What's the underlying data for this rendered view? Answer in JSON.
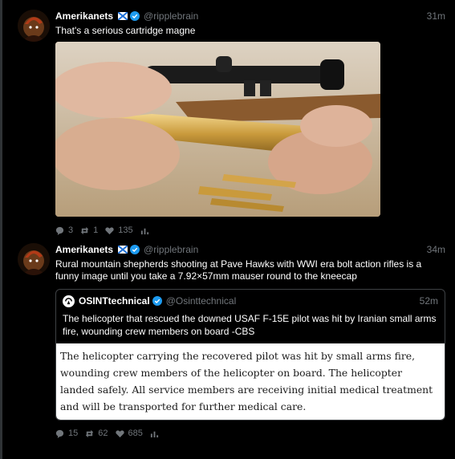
{
  "tweets": [
    {
      "name": "Amerikanets",
      "handle": "@ripplebrain",
      "time": "31m",
      "text": "That's a serious cartridge magne",
      "actions": {
        "replies": "3",
        "retweets": "1",
        "likes": "135"
      }
    },
    {
      "name": "Amerikanets",
      "handle": "@ripplebrain",
      "time": "34m",
      "text": "Rural mountain shepherds shooting at Pave Hawks with WWI era bolt action rifles is a funny image until you take a 7.92×57mm mauser round to the kneecap",
      "quote": {
        "name": "OSINTtechnical",
        "handle": "@Osinttechnical",
        "time": "52m",
        "text": "The helicopter that rescued the downed USAF F-15E pilot was hit by Iranian small arms fire, wounding crew members on board -CBS",
        "card_text": "The helicopter carrying the recovered pilot was hit by small arms fire, wounding crew members of the helicopter on board. The helicopter landed safely. All service members are receiving initial medical treatment and will be transported for further medical care."
      },
      "actions": {
        "replies": "15",
        "retweets": "62",
        "likes": "685"
      }
    }
  ],
  "icons": {
    "reply": "speech-bubble-icon",
    "retweet": "retweet-icon",
    "like": "heart-icon",
    "stats": "bar-chart-icon",
    "verified": "verified-badge-icon",
    "flag": "flag-icon"
  },
  "colors": {
    "background": "#000000",
    "muted": "#71767b",
    "verified": "#1d9bf0"
  }
}
